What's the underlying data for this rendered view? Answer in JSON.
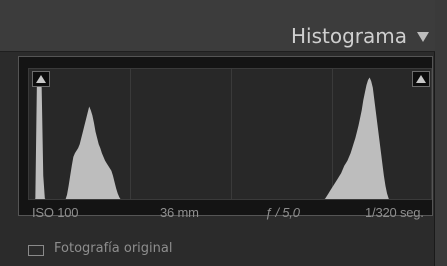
{
  "header": {
    "title": "Histograma",
    "collapse_icon": "triangle-down-icon"
  },
  "histogram": {
    "shadow_clip_icon": "triangle-up-icon",
    "highlight_clip_icon": "triangle-up-icon",
    "fill_color": "#bdbdbd",
    "levels": [
      0,
      0,
      0,
      0,
      0.02,
      0.95,
      0.98,
      0.96,
      0.9,
      0.2,
      0.02,
      0.01,
      0,
      0,
      0,
      0,
      0,
      0,
      0,
      0,
      0,
      0,
      0,
      0.01,
      0.05,
      0.12,
      0.2,
      0.28,
      0.35,
      0.38,
      0.4,
      0.42,
      0.45,
      0.5,
      0.55,
      0.6,
      0.65,
      0.7,
      0.75,
      0.72,
      0.68,
      0.62,
      0.55,
      0.5,
      0.45,
      0.42,
      0.38,
      0.35,
      0.32,
      0.3,
      0.28,
      0.26,
      0.24,
      0.2,
      0.15,
      0.1,
      0.06,
      0.03,
      0.01,
      0,
      0,
      0,
      0,
      0,
      0,
      0,
      0,
      0,
      0,
      0,
      0,
      0,
      0,
      0,
      0,
      0,
      0,
      0,
      0,
      0,
      0,
      0,
      0,
      0,
      0,
      0,
      0,
      0,
      0,
      0,
      0,
      0,
      0,
      0,
      0,
      0,
      0,
      0,
      0,
      0,
      0,
      0,
      0,
      0,
      0,
      0,
      0,
      0,
      0,
      0,
      0,
      0,
      0,
      0,
      0,
      0,
      0,
      0,
      0,
      0,
      0,
      0,
      0,
      0,
      0,
      0,
      0,
      0,
      0,
      0,
      0,
      0,
      0,
      0,
      0,
      0,
      0,
      0,
      0,
      0,
      0,
      0,
      0,
      0,
      0,
      0,
      0,
      0,
      0,
      0,
      0,
      0,
      0,
      0,
      0,
      0,
      0,
      0,
      0,
      0,
      0,
      0,
      0,
      0,
      0,
      0,
      0,
      0,
      0,
      0,
      0,
      0,
      0,
      0,
      0,
      0,
      0,
      0,
      0,
      0,
      0,
      0,
      0,
      0,
      0,
      0,
      0.01,
      0.02,
      0.04,
      0.06,
      0.08,
      0.1,
      0.12,
      0.14,
      0.16,
      0.18,
      0.2,
      0.22,
      0.25,
      0.28,
      0.3,
      0.32,
      0.35,
      0.38,
      0.42,
      0.46,
      0.5,
      0.55,
      0.6,
      0.66,
      0.72,
      0.8,
      0.86,
      0.92,
      0.96,
      0.98,
      0.95,
      0.9,
      0.8,
      0.7,
      0.6,
      0.5,
      0.4,
      0.3,
      0.2,
      0.12,
      0.06,
      0.02,
      0,
      0,
      0,
      0,
      0,
      0,
      0,
      0,
      0,
      0,
      0,
      0,
      0,
      0,
      0,
      0,
      0,
      0,
      0,
      0,
      0,
      0,
      0,
      0,
      0,
      0,
      0,
      0
    ]
  },
  "info": {
    "iso": "ISO 100",
    "focal_length": "36 mm",
    "aperture": "ƒ / 5,0",
    "shutter": "1/320 seg."
  },
  "original_photo": {
    "label": "Fotografía original",
    "checked": false
  }
}
